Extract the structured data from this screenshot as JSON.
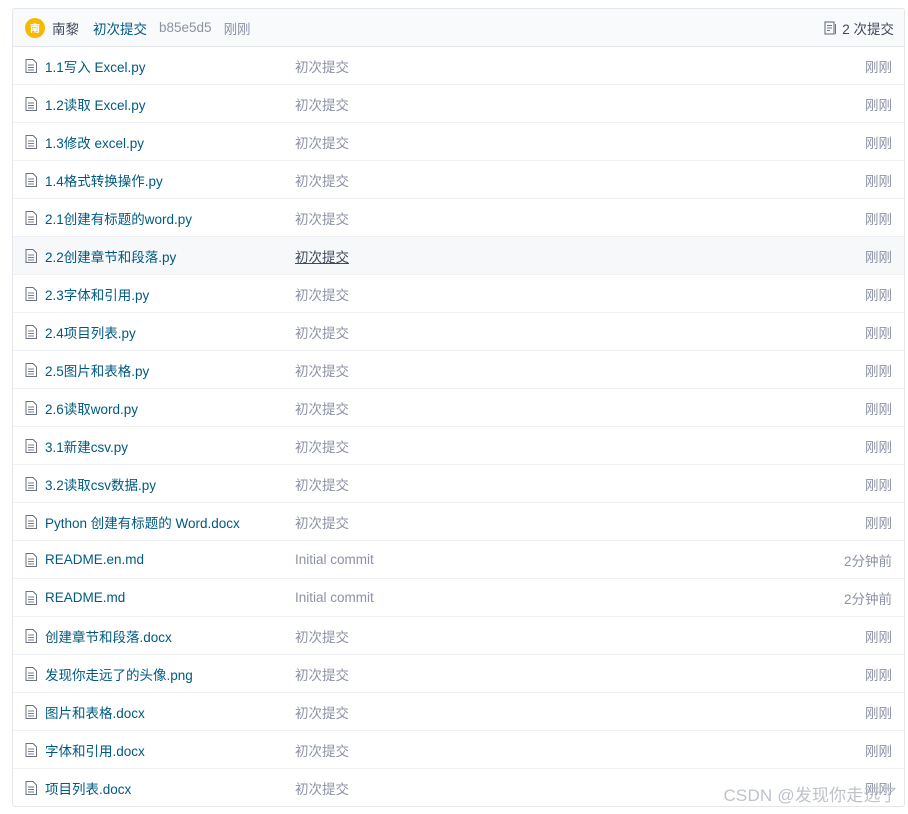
{
  "header": {
    "avatar_letter": "南",
    "author": "南黎",
    "message": "初次提交",
    "sha": "b85e5d5",
    "time": "刚刚",
    "commits_label": "2 次提交"
  },
  "files": [
    {
      "name": "1.1写入 Excel.py",
      "message": "初次提交",
      "time": "刚刚"
    },
    {
      "name": "1.2读取 Excel.py",
      "message": "初次提交",
      "time": "刚刚"
    },
    {
      "name": "1.3修改 excel.py",
      "message": "初次提交",
      "time": "刚刚"
    },
    {
      "name": "1.4格式转换操作.py",
      "message": "初次提交",
      "time": "刚刚"
    },
    {
      "name": "2.1创建有标题的word.py",
      "message": "初次提交",
      "time": "刚刚"
    },
    {
      "name": "2.2创建章节和段落.py",
      "message": "初次提交",
      "time": "刚刚"
    },
    {
      "name": "2.3字体和引用.py",
      "message": "初次提交",
      "time": "刚刚"
    },
    {
      "name": "2.4项目列表.py",
      "message": "初次提交",
      "time": "刚刚"
    },
    {
      "name": "2.5图片和表格.py",
      "message": "初次提交",
      "time": "刚刚"
    },
    {
      "name": "2.6读取word.py",
      "message": "初次提交",
      "time": "刚刚"
    },
    {
      "name": "3.1新建csv.py",
      "message": "初次提交",
      "time": "刚刚"
    },
    {
      "name": "3.2读取csv数据.py",
      "message": "初次提交",
      "time": "刚刚"
    },
    {
      "name": "Python 创建有标题的 Word.docx",
      "message": "初次提交",
      "time": "刚刚"
    },
    {
      "name": "README.en.md",
      "message": "Initial commit",
      "time": "2分钟前"
    },
    {
      "name": "README.md",
      "message": "Initial commit",
      "time": "2分钟前"
    },
    {
      "name": "创建章节和段落.docx",
      "message": "初次提交",
      "time": "刚刚"
    },
    {
      "name": "发现你走远了的头像.png",
      "message": "初次提交",
      "time": "刚刚"
    },
    {
      "name": "图片和表格.docx",
      "message": "初次提交",
      "time": "刚刚"
    },
    {
      "name": "字体和引用.docx",
      "message": "初次提交",
      "time": "刚刚"
    },
    {
      "name": "项目列表.docx",
      "message": "初次提交",
      "time": "刚刚"
    }
  ],
  "watermark": "CSDN @发现你走远了",
  "icons": {
    "file": "file-icon",
    "commits": "commit-history-icon"
  },
  "colors": {
    "link": "#005980",
    "muted": "#8c92a4",
    "avatar": "#f7b800"
  }
}
